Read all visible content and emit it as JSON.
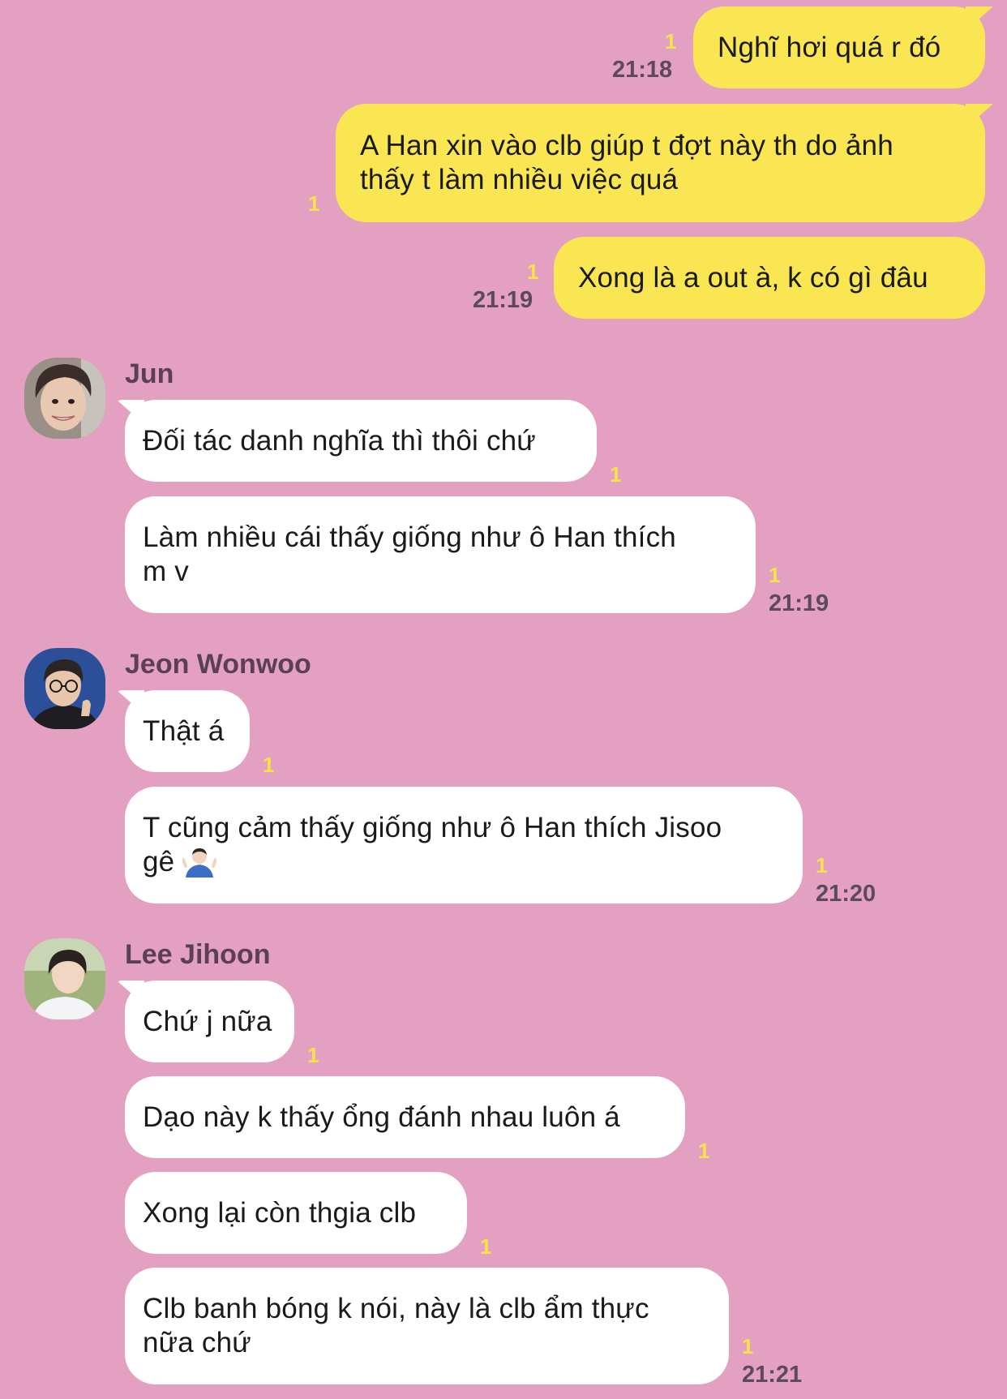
{
  "outgoing": [
    {
      "text": "Nghĩ hơi quá r đó",
      "unread": "1",
      "time": "21:18"
    },
    {
      "text": "A Han xin vào clb giúp t đợt này th do ảnh\nthấy t làm nhiều việc quá",
      "unread": "1",
      "time": ""
    },
    {
      "text": "Xong là a out à, k có gì đâu",
      "unread": "1",
      "time": "21:19"
    }
  ],
  "groups": [
    {
      "sender": "Jun",
      "avatar_icon": "person-avatar-jun",
      "messages": [
        {
          "text": "Đối tác danh nghĩa thì thôi chứ",
          "unread": "1",
          "time": ""
        },
        {
          "text": "Làm nhiều cái thấy giống như ô Han thích\nm v",
          "unread": "1",
          "time": "21:19"
        }
      ]
    },
    {
      "sender": "Jeon Wonwoo",
      "avatar_icon": "person-avatar-jeon-wonwoo",
      "messages": [
        {
          "text": "Thật á",
          "unread": "1",
          "time": ""
        },
        {
          "text": "T cũng cảm thấy giống như ô Han thích Jisoo\ngê",
          "emoji": "person-shrugging-emoji",
          "unread": "1",
          "time": "21:20"
        }
      ]
    },
    {
      "sender": "Lee Jihoon",
      "avatar_icon": "person-avatar-lee-jihoon",
      "messages": [
        {
          "text": "Chứ j nữa",
          "unread": "1",
          "time": ""
        },
        {
          "text": "Dạo này k thấy ổng đánh nhau luôn á",
          "unread": "1",
          "time": ""
        },
        {
          "text": "Xong lại còn thgia clb",
          "unread": "1",
          "time": ""
        },
        {
          "text": "Clb banh bóng k nói, này là clb ẩm thực\nnữa chứ",
          "unread": "1",
          "time": "21:21"
        }
      ]
    }
  ],
  "colors": {
    "background": "#e4a0c0",
    "outgoing_bubble": "#f9e652",
    "incoming_bubble": "#ffffff",
    "unread_count": "#f7e24a"
  }
}
